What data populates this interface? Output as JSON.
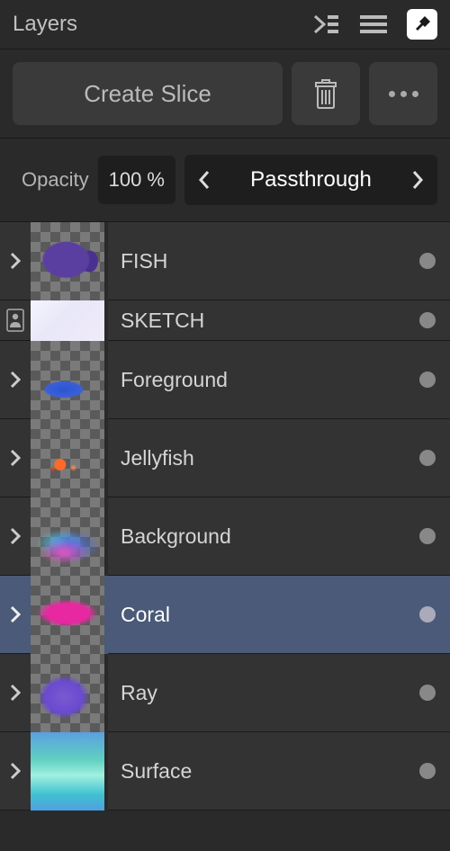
{
  "header": {
    "title": "Layers"
  },
  "toolbar": {
    "create_slice": "Create Slice"
  },
  "props": {
    "opacity_label": "Opacity",
    "opacity_value": "100 %",
    "blend_mode": "Passthrough"
  },
  "layers": [
    {
      "name": "FISH",
      "expandable": true,
      "badge": null,
      "selected": false,
      "art": "art-fish",
      "short": false
    },
    {
      "name": "SKETCH",
      "expandable": false,
      "badge": "person",
      "selected": false,
      "art": "art-sketch",
      "short": true
    },
    {
      "name": "Foreground",
      "expandable": true,
      "badge": null,
      "selected": false,
      "art": "art-fg",
      "short": false
    },
    {
      "name": "Jellyfish",
      "expandable": true,
      "badge": null,
      "selected": false,
      "art": "art-jelly",
      "short": false
    },
    {
      "name": "Background",
      "expandable": true,
      "badge": null,
      "selected": false,
      "art": "art-bg",
      "short": false
    },
    {
      "name": "Coral",
      "expandable": true,
      "badge": null,
      "selected": true,
      "art": "art-coral",
      "short": false
    },
    {
      "name": "Ray",
      "expandable": true,
      "badge": null,
      "selected": false,
      "art": "art-ray",
      "short": false
    },
    {
      "name": "Surface",
      "expandable": true,
      "badge": null,
      "selected": false,
      "art": "art-surface",
      "short": false
    }
  ]
}
